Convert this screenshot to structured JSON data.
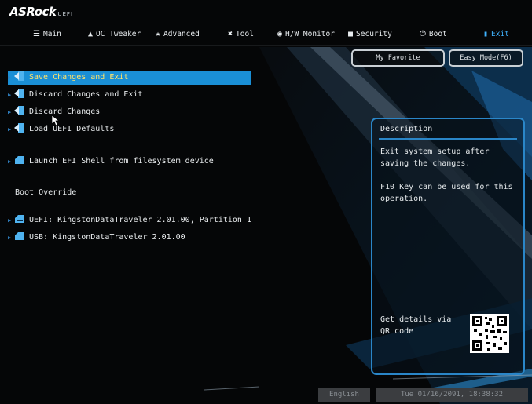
{
  "brand": {
    "name": "ASRock",
    "suffix": "UEFI"
  },
  "tabs": [
    {
      "label": "Main",
      "icon": "list-icon"
    },
    {
      "label": "OC Tweaker",
      "icon": "rocket-icon"
    },
    {
      "label": "Advanced",
      "icon": "star-icon"
    },
    {
      "label": "Tool",
      "icon": "tools-icon"
    },
    {
      "label": "H/W Monitor",
      "icon": "monitor-icon"
    },
    {
      "label": "Security",
      "icon": "shield-icon"
    },
    {
      "label": "Boot",
      "icon": "power-icon"
    },
    {
      "label": "Exit",
      "icon": "exit-icon"
    }
  ],
  "active_tab": "Exit",
  "buttons": {
    "favorite": "My Favorite",
    "easy_mode": "Easy Mode(F6)"
  },
  "menu": [
    {
      "label": "Save Changes and Exit",
      "icon": "exit-door-icon",
      "selected": true
    },
    {
      "label": "Discard Changes and Exit",
      "icon": "exit-door-icon"
    },
    {
      "label": "Discard Changes",
      "icon": "exit-door-icon"
    },
    {
      "label": "Load UEFI Defaults",
      "icon": "exit-door-icon"
    },
    {
      "label": "Launch EFI Shell from filesystem device",
      "icon": "drive-icon"
    }
  ],
  "boot_override": {
    "header": "Boot Override",
    "items": [
      {
        "label": "UEFI: KingstonDataTraveler 2.01.00, Partition 1",
        "icon": "drive-icon"
      },
      {
        "label": "USB: KingstonDataTraveler 2.01.00",
        "icon": "drive-icon"
      }
    ]
  },
  "description": {
    "title": "Description",
    "text1": "Exit system setup after saving the changes.",
    "text2": "F10 Key can be used for this operation.",
    "qr_label": "Get details via QR code"
  },
  "status": {
    "language": "English",
    "datetime": "Tue 01/16/2091, 18:38:32"
  },
  "colors": {
    "accent": "#1a8fd6",
    "selected_text": "#ffe36b",
    "active_tab": "#3fb3ff",
    "panel_border": "#2a86c8"
  }
}
